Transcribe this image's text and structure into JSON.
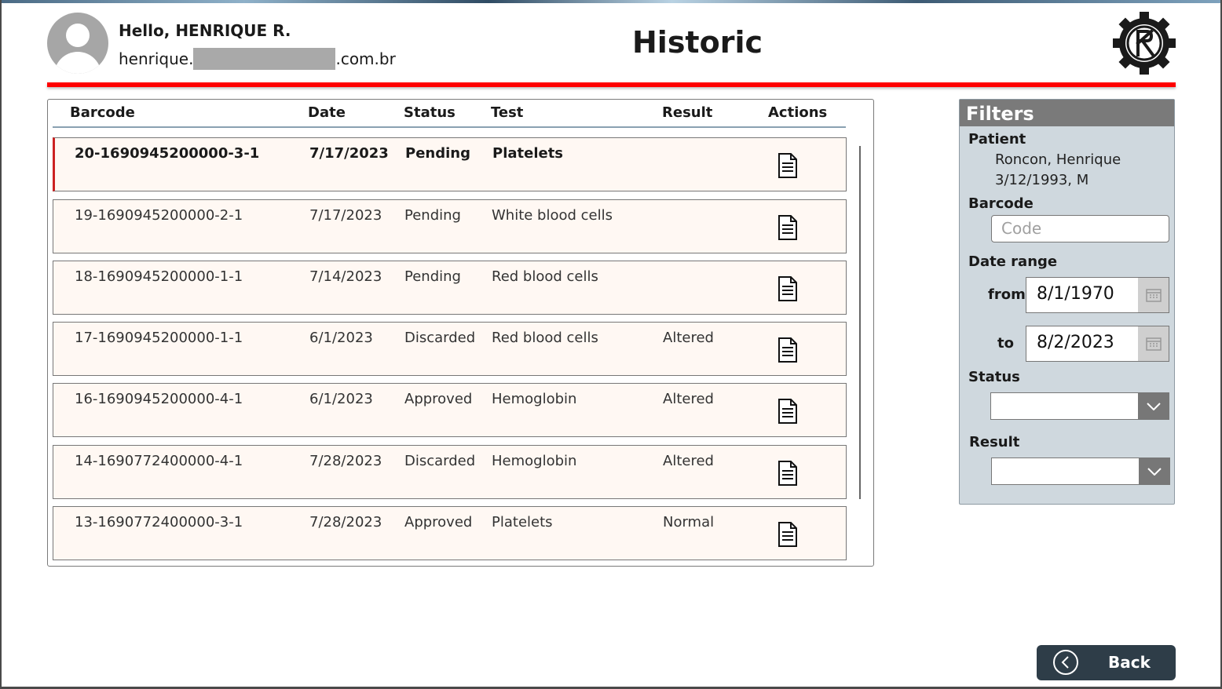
{
  "header": {
    "greeting": "Hello, HENRIQUE R.",
    "email_prefix": "henrique.",
    "email_suffix": ".com.br",
    "title": "Historic"
  },
  "table": {
    "columns": [
      "Barcode",
      "Date",
      "Status",
      "Test",
      "Result",
      "Actions"
    ],
    "rows": [
      {
        "barcode": "20-1690945200000-3-1",
        "date": "7/17/2023",
        "status": "Pending",
        "test": "Platelets",
        "result": ""
      },
      {
        "barcode": "19-1690945200000-2-1",
        "date": "7/17/2023",
        "status": "Pending",
        "test": "White blood cells",
        "result": ""
      },
      {
        "barcode": "18-1690945200000-1-1",
        "date": "7/14/2023",
        "status": "Pending",
        "test": "Red blood cells",
        "result": ""
      },
      {
        "barcode": "17-1690945200000-1-1",
        "date": "6/1/2023",
        "status": "Discarded",
        "test": "Red blood cells",
        "result": "Altered"
      },
      {
        "barcode": "16-1690945200000-4-1",
        "date": "6/1/2023",
        "status": "Approved",
        "test": "Hemoglobin",
        "result": "Altered"
      },
      {
        "barcode": "14-1690772400000-4-1",
        "date": "7/28/2023",
        "status": "Discarded",
        "test": "Hemoglobin",
        "result": "Altered"
      },
      {
        "barcode": "13-1690772400000-3-1",
        "date": "7/28/2023",
        "status": "Approved",
        "test": "Platelets",
        "result": "Normal"
      }
    ],
    "action_icon": "document-icon"
  },
  "filters": {
    "title": "Filters",
    "patient_label": "Patient",
    "patient_name": "Roncon, Henrique",
    "patient_info": "3/12/1993, M",
    "barcode_label": "Barcode",
    "barcode_placeholder": "Code",
    "date_range_label": "Date range",
    "from_label": "from",
    "from_value": "8/1/1970",
    "to_label": "to",
    "to_value": "8/2/2023",
    "status_label": "Status",
    "status_value": "",
    "result_label": "Result",
    "result_value": ""
  },
  "footer": {
    "back_label": "Back"
  },
  "colors": {
    "accent_red": "#ff0000",
    "row_bg": "#fff8f3",
    "filters_bg": "#cfd8de",
    "back_button": "#2e3d48"
  }
}
